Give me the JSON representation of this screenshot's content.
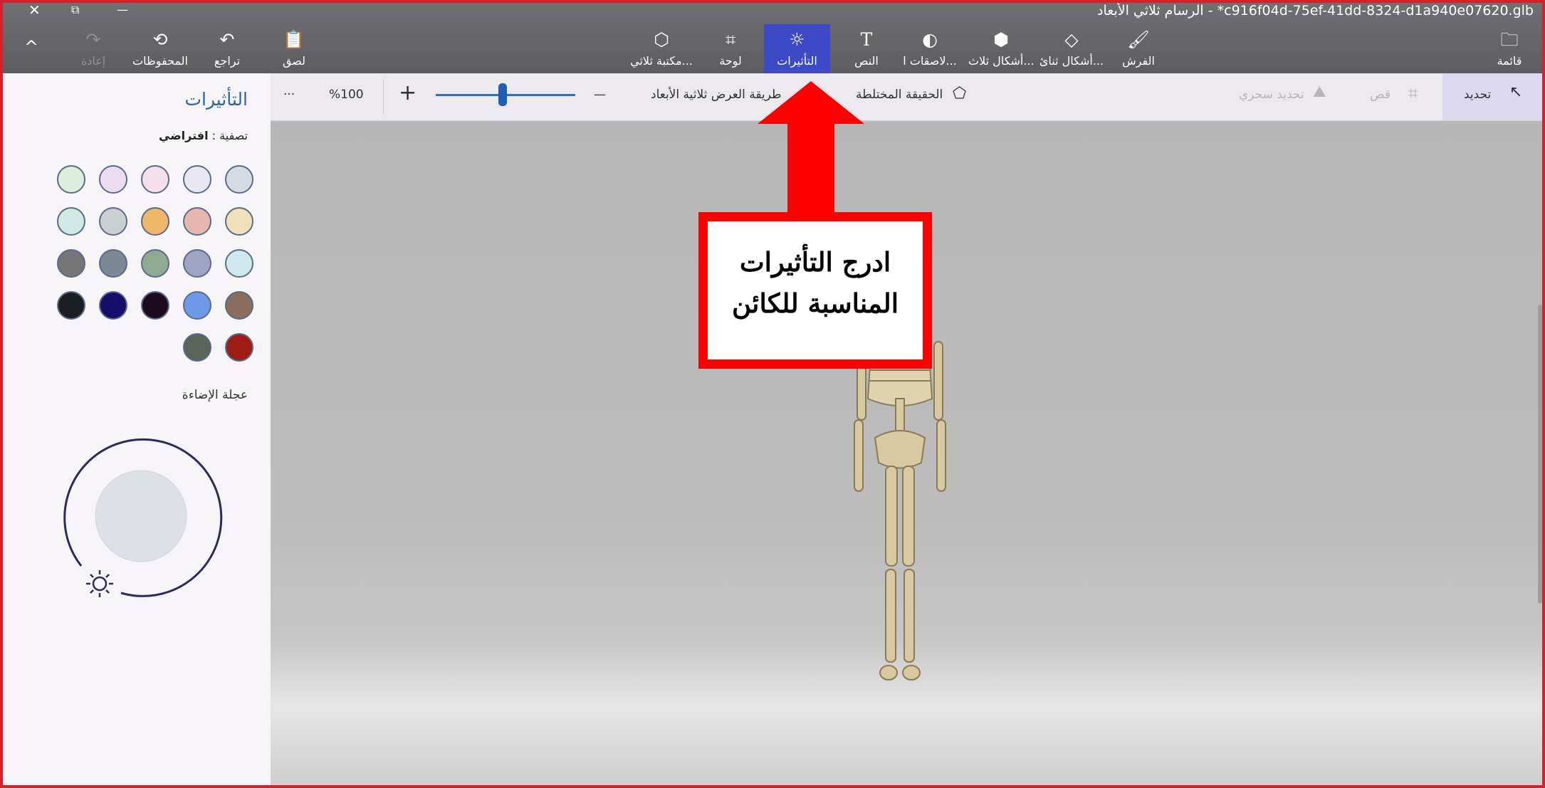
{
  "window": {
    "title": "c916f04d-75ef-41dd-8324-d1a940e07620.glb* - الرسام ثلاثي الأبعاد",
    "close": "✕",
    "restore": "⧉",
    "minimize": "—"
  },
  "ribbon": {
    "collapse": "^",
    "redo": "إعادة",
    "history": "المحفوظات",
    "undo": "تراجع",
    "paste": "لصق",
    "library_3d": "مكتبة ثلاثي...",
    "canvas": "لوحة",
    "effects": "التأثيرات",
    "text": "النص",
    "stickers": "لاصقات ا...",
    "shapes_3d": "أشكال ثلاث...",
    "shapes_2d": "أشكال ثنائ...",
    "brushes": "الفرش",
    "menu": "قائمة"
  },
  "toolbar": {
    "select": "تحديد",
    "crop": "قص",
    "magic_select": "تحديد سحري",
    "mixed_reality": "الحقيقة المختلطة",
    "view_3d": "طريقة العرض ثلاثية الأبعاد",
    "zoom_out": "—",
    "zoom_in": "+",
    "zoom_value": "%100",
    "zoom_fraction": 0.48,
    "more": "···"
  },
  "panel": {
    "title": "التأثيرات",
    "filter_label": "تصفية :",
    "filter_value": "افتراضي",
    "lighting_wheel_label": "عجلة الإضاءة",
    "swatches": [
      [
        "#d6dbe3",
        "#e8e8f3",
        "#f5dfe8",
        "#ecdcf0",
        "#dcefdd"
      ],
      [
        "#f1e0bd",
        "#e5b7ae",
        "#efb869",
        "#c9cfd0",
        "#cdeae3"
      ],
      [
        "#cde9ec",
        "#9fa4c4",
        "#8fa993",
        "#7c8896",
        "#767676"
      ],
      [
        "#8a6d5c",
        "#6d9ae8",
        "#1c0b1f",
        "#170d6b",
        "#1b1f22"
      ],
      [
        "#9e1b12",
        "#5a6358"
      ]
    ]
  },
  "callout": {
    "line1": "ادرج التأثيرات",
    "line2": "المناسبة للكائن",
    "color": "#ff0000"
  }
}
